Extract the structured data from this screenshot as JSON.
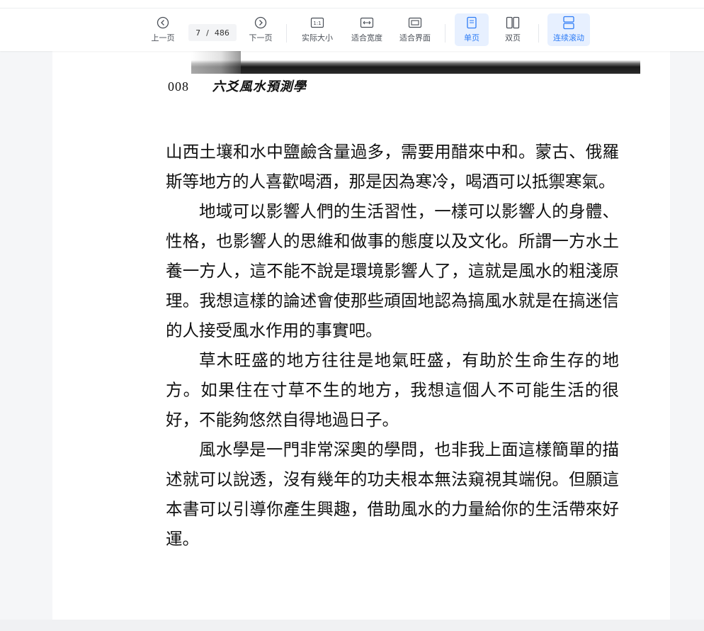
{
  "toolbar": {
    "prev_label": "上一页",
    "next_label": "下一页",
    "current_page": "7",
    "page_separator": "/",
    "total_pages": "486",
    "actual_size_label": "实际大小",
    "fit_width_label": "适合宽度",
    "fit_screen_label": "适合界面",
    "single_page_label": "单页",
    "double_page_label": "双页",
    "continuous_scroll_label": "连续滚动",
    "actual_size_icon_text": "1:1",
    "accent_color": "#2f7df6"
  },
  "document": {
    "page_number": "008",
    "book_title": "六爻風水預測學",
    "paragraphs": [
      "山西土壤和水中鹽鹼含量過多，需要用醋來中和。蒙古、俄羅斯等地方的人喜歡喝酒，那是因為寒冷，喝酒可以抵禦寒氣。",
      "地域可以影響人們的生活習性，一樣可以影響人的身體、性格，也影響人的思維和做事的態度以及文化。所謂一方水土養一方人，這不能不說是環境影響人了，這就是風水的粗淺原理。我想這樣的論述會使那些頑固地認為搞風水就是在搞迷信的人接受風水作用的事實吧。",
      "草木旺盛的地方往往是地氣旺盛，有助於生命生存的地方。如果住在寸草不生的地方，我想這個人不可能生活的很好，不能夠悠然自得地過日子。",
      "風水學是一門非常深奧的學問，也非我上面這樣簡單的描述就可以說透，沒有幾年的功夫根本無法窺視其端倪。但願這本書可以引導你產生興趣，借助風水的力量給你的生活帶來好運。"
    ]
  }
}
